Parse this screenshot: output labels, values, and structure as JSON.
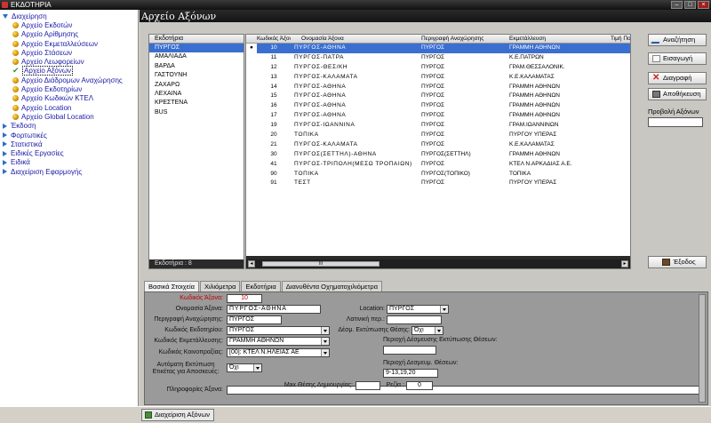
{
  "window": {
    "title": "ΕΚΔΟΤΗΡΙΑ"
  },
  "tree": {
    "items": [
      {
        "label": "Διαχείρηση",
        "level": 0,
        "icon": "expanded-arrow-icon"
      },
      {
        "label": "Αρχείο Εκδοτών",
        "level": 1,
        "icon": "folder-ball-icon"
      },
      {
        "label": "Αρχείο Αρίθμησης",
        "level": 1,
        "icon": "folder-ball-icon"
      },
      {
        "label": "Αρχείο Εκμεταλλεύσεων",
        "level": 1,
        "icon": "folder-ball-icon"
      },
      {
        "label": "Αρχείο Στάσεων",
        "level": 1,
        "icon": "folder-ball-icon"
      },
      {
        "label": "Αρχείο Λεωφορείων",
        "level": 1,
        "icon": "folder-ball-icon"
      },
      {
        "label": "Αρχείο Αξόνων",
        "level": 1,
        "icon": "checkmark-icon",
        "selected": true
      },
      {
        "label": "Αρχείο Διάδρομων Αναχώρησης",
        "level": 1,
        "icon": "folder-ball-icon"
      },
      {
        "label": "Αρχείο Εκδοτηρίων",
        "level": 1,
        "icon": "folder-ball-icon"
      },
      {
        "label": "Αρχείο Κωδικών ΚΤΕΛ",
        "level": 1,
        "icon": "folder-ball-icon"
      },
      {
        "label": "Αρχείο Location",
        "level": 1,
        "icon": "folder-ball-icon"
      },
      {
        "label": "Αρχείο Global Location",
        "level": 1,
        "icon": "folder-ball-icon"
      },
      {
        "label": "Έκδοση",
        "level": 0,
        "icon": "collapsed-arrow-icon"
      },
      {
        "label": "Φορτωτικές",
        "level": 0,
        "icon": "collapsed-arrow-icon"
      },
      {
        "label": "Στατιστικά",
        "level": 0,
        "icon": "collapsed-arrow-icon"
      },
      {
        "label": "Ειδικές Εργασίες",
        "level": 0,
        "icon": "collapsed-arrow-icon"
      },
      {
        "label": "Ειδικά",
        "level": 0,
        "icon": "collapsed-arrow-icon"
      },
      {
        "label": "Διαχείριση Εφαρμογής",
        "level": 0,
        "icon": "collapsed-arrow-icon"
      }
    ]
  },
  "main": {
    "title": "Αρχείο Αξόνων",
    "stations": {
      "header": "Εκδοτήρια",
      "items": [
        "ΠΥΡΓΟΣ",
        "ΑΜΑΛΙΑΔΑ",
        "ΒΑΡΔΑ",
        "ΓΑΣΤΟΥΝΗ",
        "ΖΑΧΑΡΩ",
        "ΛΕΧΑΙΝΑ",
        "ΚΡΕΣΤΕΝΑ",
        "BUS"
      ],
      "footer": "Εκδοτήρια : 8"
    },
    "axes": {
      "columns": {
        "code": "Κωδικός Άξονα",
        "name": "Ονομασία Άξονα",
        "desc": "Περιγραφή Αναχώρησης",
        "oper": "Εκμετάλλευση",
        "price": "Τιμή Πο"
      },
      "rows": [
        {
          "code": "10",
          "name": "ΠΥΡΓΟΣ-ΑΘΗΝΑ",
          "desc": "ΠΥΡΓΟΣ",
          "oper": "ΓΡΑΜΜΗ ΑΘΗΝΩΝ",
          "sel": true
        },
        {
          "code": "11",
          "name": "ΠΥΡΓΟΣ-ΠΑΤΡΑ",
          "desc": "ΠΥΡΓΟΣ",
          "oper": "Κ.Ε.ΠΑΤΡΩΝ"
        },
        {
          "code": "12",
          "name": "ΠΥΡΓΟΣ-ΘΕΣ/ΚΗ",
          "desc": "ΠΥΡΓΟΣ",
          "oper": "ΓΡΑΜ.ΘΕΣΣΑΛΟΝΙΚ."
        },
        {
          "code": "13",
          "name": "ΠΥΡΓΟΣ-ΚΑΛΑΜΑΤΑ",
          "desc": "ΠΥΡΓΟΣ",
          "oper": "Κ.Ε.ΚΑΛΑΜΑΤΑΣ"
        },
        {
          "code": "14",
          "name": "ΠΥΡΓΟΣ-ΑΘΗΝΑ",
          "desc": "ΠΥΡΓΟΣ",
          "oper": "ΓΡΑΜΜΗ ΑΘΗΝΩΝ"
        },
        {
          "code": "15",
          "name": "ΠΥΡΓΟΣ-ΑΘΗΝΑ",
          "desc": "ΠΥΡΓΟΣ",
          "oper": "ΓΡΑΜΜΗ ΑΘΗΝΩΝ"
        },
        {
          "code": "16",
          "name": "ΠΥΡΓΟΣ-ΑΘΗΝΑ",
          "desc": "ΠΥΡΓΟΣ",
          "oper": "ΓΡΑΜΜΗ ΑΘΗΝΩΝ"
        },
        {
          "code": "17",
          "name": "ΠΥΡΓΟΣ-ΑΘΗΝΑ",
          "desc": "ΠΥΡΓΟΣ",
          "oper": "ΓΡΑΜΜΗ ΑΘΗΝΩΝ"
        },
        {
          "code": "19",
          "name": "ΠΥΡΓΟΣ-ΙΩΑΝΝΙΝΑ",
          "desc": "ΠΥΡΓΟΣ",
          "oper": "ΓΡΑΜ.ΙΩΑΝΝΙΝΩΝ"
        },
        {
          "code": "20",
          "name": "ΤΟΠΙΚΑ",
          "desc": "ΠΥΡΓΟΣ",
          "oper": "ΠΥΡΓΟΥ ΥΠΕΡΑΣ"
        },
        {
          "code": "21",
          "name": "ΠΥΡΓΟΣ-ΚΑΛΑΜΑΤΑ",
          "desc": "ΠΥΡΓΟΣ",
          "oper": "Κ.Ε.ΚΑΛΑΜΑΤΑΣ"
        },
        {
          "code": "30",
          "name": "ΠΥΡΓΟΣ(ΣΕΤΤΗΛ)-ΑΘΗΝΑ",
          "desc": "ΠΥΡΓΟΣ(ΣΕΤΤΗΛ)",
          "oper": "ΓΡΑΜΜΗ ΑΘΗΝΩΝ"
        },
        {
          "code": "41",
          "name": "ΠΥΡΓΟΣ-ΤΡΙΠΟΛΗ(ΜΕΣΩ ΤΡΟΠΑΙΩΝ)",
          "desc": "ΠΥΡΓΟΣ",
          "oper": "ΚΤΕΛ Ν.ΑΡΚΑΔΙΑΣ Α.Ε."
        },
        {
          "code": "90",
          "name": "ΤΟΠΙΚΑ",
          "desc": "ΠΥΡΓΟΣ(ΤΟΠΙΚΟ)",
          "oper": "ΤΟΠΙΚΑ"
        },
        {
          "code": "91",
          "name": "ΤΕΣΤ",
          "desc": "ΠΥΡΓΟΣ",
          "oper": "ΠΥΡΓΟΥ ΥΠΕΡΑΣ"
        }
      ],
      "scroll_label": "III"
    },
    "buttons": {
      "search": "Αναζήτηση",
      "insert": "Εισαγωγή",
      "delete": "Διαγραφή",
      "save": "Αποθήκευση",
      "view_label": "Προβολή Αξόνων",
      "exit": "Έξοδος"
    },
    "tabs": [
      "Βασικά Στοιχεία",
      "Χιλιόμετρα",
      "Εκδοτήρια",
      "Διανυθέντα Οχηματοχιλιόμετρα"
    ],
    "form": {
      "axis_code_label": "Κωδικός Άξονα:",
      "axis_code": "10",
      "axis_name_label": "Ονομασία Άξονα:",
      "axis_name": "ΠΥΡΓΟΣ-ΑΘΗΝΑ",
      "dep_desc_label": "Περιγραφή Αναχώρησης:",
      "dep_desc": "ΠΥΡΓΟΣ",
      "station_code_label": "Κωδικός Εκδοτηρίου:",
      "station_code": "ΠΥΡΓΟΣ",
      "oper_code_label": "Κωδικός Εκμετάλλευσης:",
      "oper_code": "ΓΡΑΜΜΗ ΑΘΗΝΩΝ",
      "coop_code_label": "Κωδικός Κοινοπραξίας:",
      "coop_code": "[00]: ΚΤΕΛ Ν.ΗΛΕΙΑΣ ΑΕ",
      "auto_print_label": "Αυτόματη Εκτύπωση Ετικέτας για Αποσκευές:",
      "auto_print": "Όχι",
      "info_label": "Πληροφορίες Άξονα:",
      "info": "",
      "location_label": "Location:",
      "location": "ΠΥΡΓΟΣ",
      "latin_label": "Λατινική περ.:",
      "latin": "",
      "seat_res_label": "Δέσμ. Εκτύπωσης Θέσης:",
      "seat_res": "Όχι",
      "seat_print_desc_label": "Περιοχή Δέσμευσης Εκτύπωσης Θέσεων:",
      "seat_print_desc": "",
      "seat_area_label": "Περιοχή Δεσμευμ. Θέσεων:",
      "seat_area": "9-13,19,20",
      "max_seat_label": "Max Θέσης Δημιουργίας:",
      "max_seat": "",
      "rezia_label": "Ρεζία :",
      "rezia": "0"
    }
  },
  "taskbar": {
    "tab_label": "Διαχείριση Αξόνων"
  }
}
